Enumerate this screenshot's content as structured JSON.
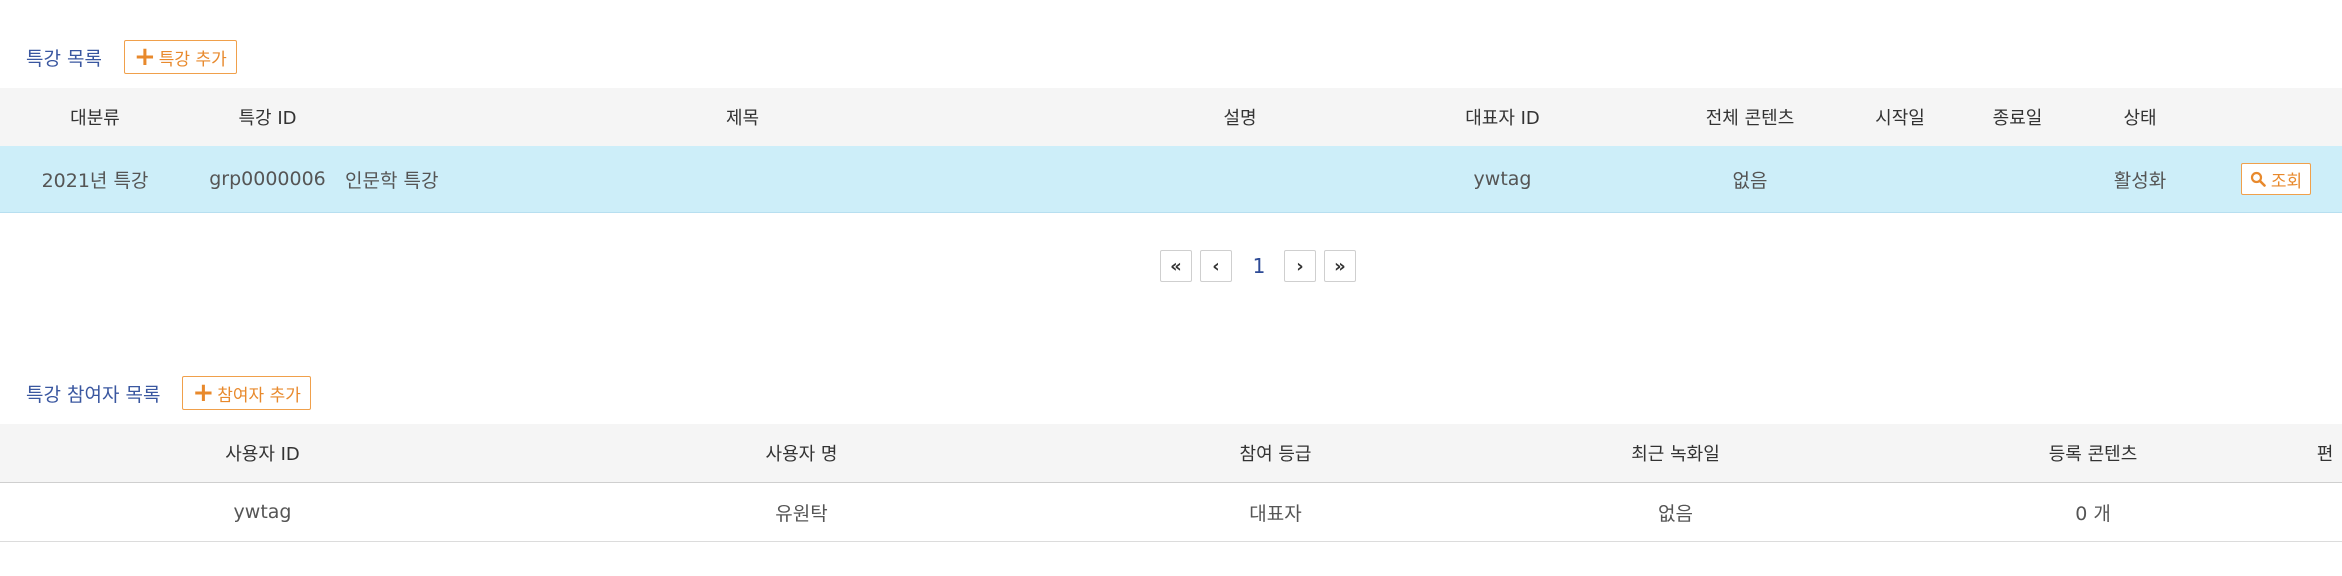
{
  "lectures": {
    "title": "특강 목록",
    "add_label": "특강 추가",
    "columns": [
      "대분류",
      "특강 ID",
      "제목",
      "설명",
      "대표자 ID",
      "전체 콘텐츠",
      "시작일",
      "종료일",
      "상태",
      ""
    ],
    "rows": [
      {
        "category": "2021년 특강",
        "id": "grp0000006",
        "title": "인문학 특강",
        "description": "",
        "owner_id": "ywtag",
        "total_contents": "없음",
        "start_date": "",
        "end_date": "",
        "status": "활성화",
        "action_label": "조회"
      }
    ]
  },
  "pagination": {
    "first": "«",
    "prev": "‹",
    "current": "1",
    "next": "›",
    "last": "»"
  },
  "participants": {
    "title": "특강 참여자 목록",
    "add_label": "참여자 추가",
    "columns": [
      "사용자 ID",
      "사용자 명",
      "참여 등급",
      "최근 녹화일",
      "등록 콘텐츠",
      "편"
    ],
    "rows": [
      {
        "user_id": "ywtag",
        "user_name": "유원탁",
        "grade": "대표자",
        "last_recorded": "없음",
        "registered_contents": "0 개",
        "edit": ""
      }
    ]
  },
  "colors": {
    "accent_orange": "#f0a04b",
    "link_blue": "#2e4b96",
    "selected_row": "#cdeef9",
    "status_green": "#3fae6b"
  }
}
